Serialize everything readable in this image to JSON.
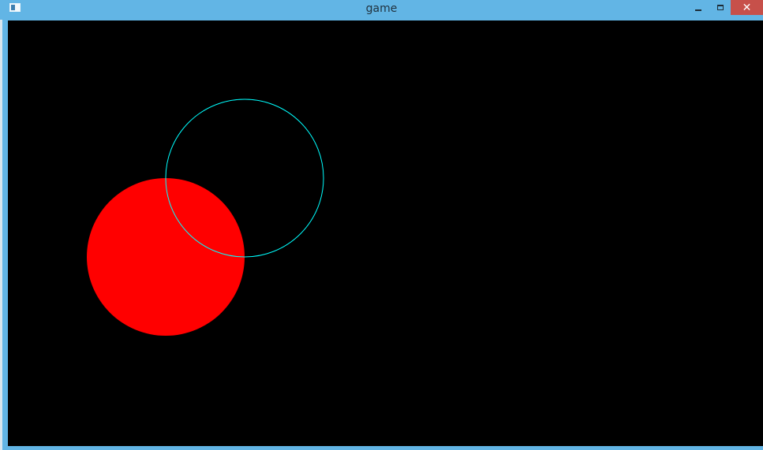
{
  "window": {
    "title": "game",
    "close_symbol": "✕",
    "colors": {
      "frame": "#62b5e5",
      "close": "#c7504a",
      "canvas": "#000000"
    }
  },
  "scene": {
    "filled_circle": {
      "fill": "#ff0000"
    },
    "outline_circle": {
      "stroke": "#00ffff"
    }
  }
}
